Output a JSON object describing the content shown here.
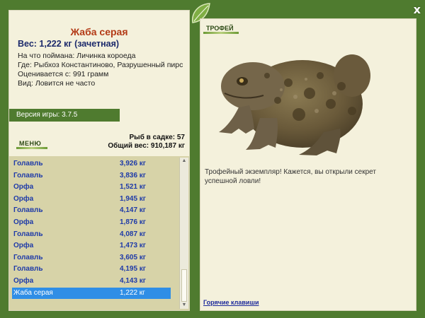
{
  "fish": {
    "name": "Жаба серая",
    "weight": "Вес: 1,222 кг (зачетная)",
    "bait": "На что поймана: Личинка короеда",
    "location": "Где: Рыбхоз Константиново, Разрушенный пирс",
    "estimated": "Оценивается с: 991 грамм",
    "species": "Вид: Ловится не часто"
  },
  "version": "Версия игры: 3.7.5",
  "menu_label": "МЕНЮ",
  "stats": {
    "count": "Рыб в садке: 57",
    "total": "Общий вес: 910,187 кг"
  },
  "catch_list": [
    {
      "name": "Голавль",
      "weight": "3,926 кг"
    },
    {
      "name": "Голавль",
      "weight": "3,836 кг"
    },
    {
      "name": "Орфа",
      "weight": "1,521 кг"
    },
    {
      "name": "Орфа",
      "weight": "1,945 кг"
    },
    {
      "name": "Голавль",
      "weight": "4,147 кг"
    },
    {
      "name": "Орфа",
      "weight": "1,876 кг"
    },
    {
      "name": "Голавль",
      "weight": "4,087 кг"
    },
    {
      "name": "Орфа",
      "weight": "1,473 кг"
    },
    {
      "name": "Голавль",
      "weight": "3,605 кг"
    },
    {
      "name": "Голавль",
      "weight": "4,195 кг"
    },
    {
      "name": "Орфа",
      "weight": "4,143 кг"
    },
    {
      "name": "Жаба серая",
      "weight": "1,222 кг"
    }
  ],
  "selected_index": 11,
  "trophy": {
    "label": "ТРОФЕЙ",
    "text": "Трофейный экземпляр! Кажется, вы открыли секрет успешной ловли!"
  },
  "hotkeys": "Горячие клавиши",
  "close": "x",
  "colors": {
    "frame": "#4f7b2f",
    "panel": "#f4f1dc",
    "title": "#b33a16",
    "list_text": "#1e3aa8",
    "selected": "#2f8ee6"
  }
}
